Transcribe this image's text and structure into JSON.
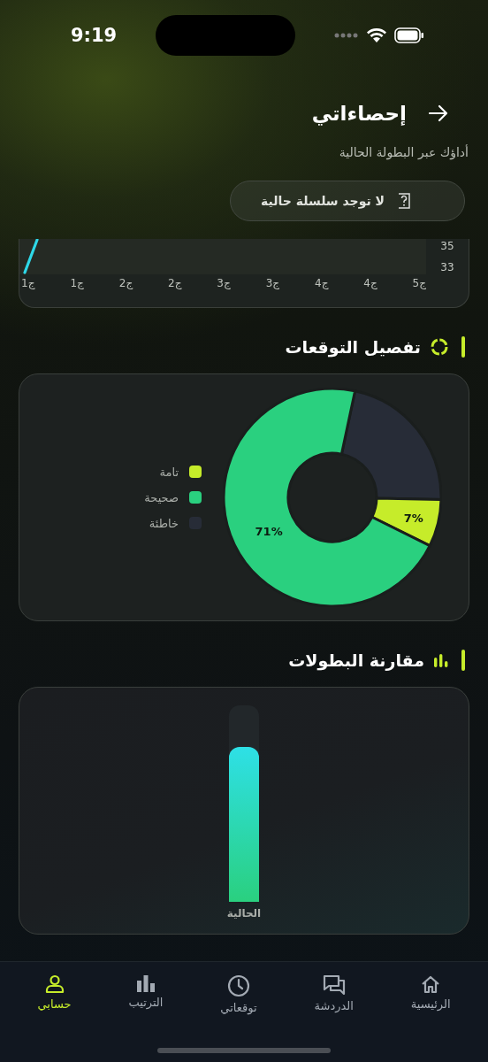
{
  "status_bar": {
    "time": "9:19"
  },
  "header": {
    "title": "إحصاءاتي",
    "subtitle": "أداؤك عبر البطولة الحالية"
  },
  "streak": {
    "label": "لا توجد سلسلة حالية"
  },
  "line_chart": {
    "y_labels": [
      "35",
      "33"
    ],
    "x_labels": [
      "ج5",
      "ج4",
      "ج4",
      "ج3",
      "ج3",
      "ج2",
      "ج2",
      "ج1",
      "ج1"
    ]
  },
  "breakdown": {
    "title": "تفصيل التوقعات",
    "chart_data": {
      "type": "donut",
      "categories": [
        "تامة",
        "صحيحة",
        "خاطئة"
      ],
      "series": [
        {
          "values": [
            7,
            71,
            22
          ]
        }
      ],
      "colors": [
        "#c6ec2a",
        "#2ad07f",
        "#272c37"
      ],
      "value_labels": [
        "7%",
        "71%",
        null
      ]
    }
  },
  "comparison": {
    "title": "مقارنة البطولات",
    "bars": [
      {
        "label": "الحالية",
        "level": 0.79
      }
    ]
  },
  "nav": [
    {
      "label": "الرئيسية",
      "selected": false
    },
    {
      "label": "الدردشة",
      "selected": false
    },
    {
      "label": "توقعاتي",
      "selected": false
    },
    {
      "label": "الترتيب",
      "selected": false
    },
    {
      "label": "حسابي",
      "selected": true
    }
  ]
}
